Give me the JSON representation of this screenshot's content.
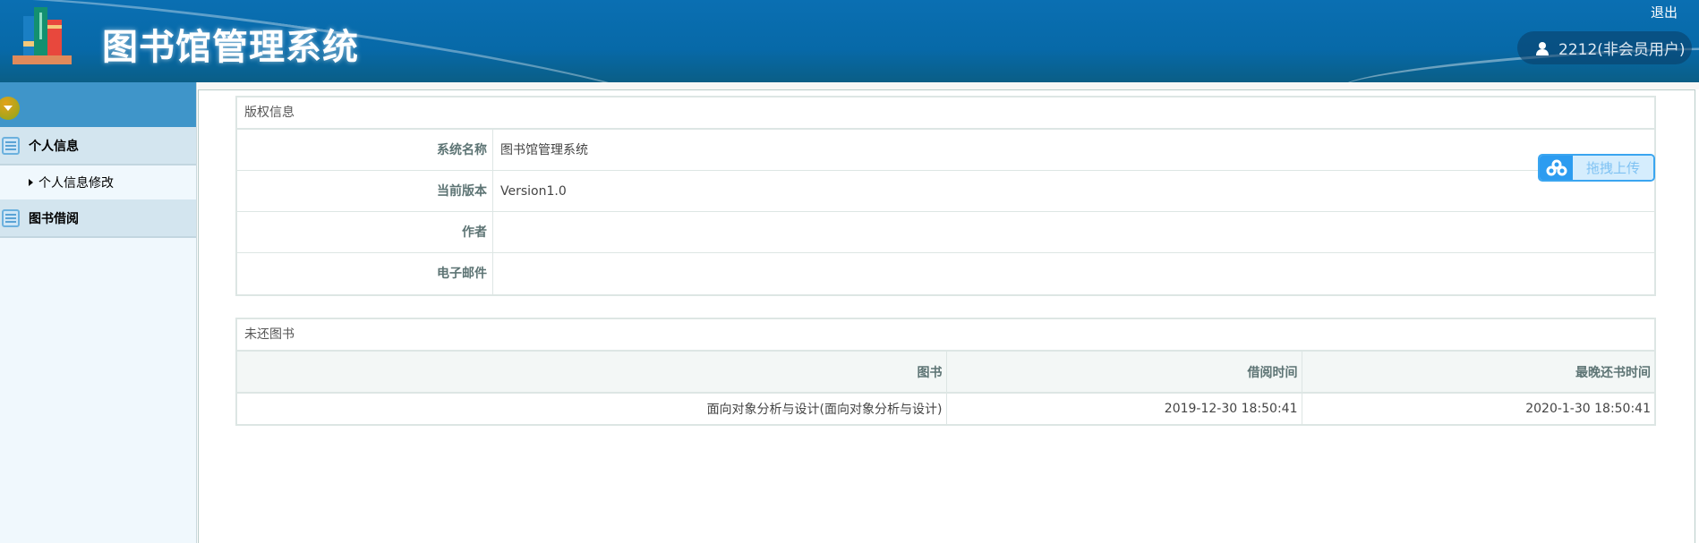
{
  "header": {
    "title": "图书馆管理系统",
    "logout": "退出",
    "user": "2212(非会员用户)"
  },
  "sidebar": {
    "groups": [
      {
        "label": "个人信息",
        "items": [
          {
            "label": "个人信息修改"
          }
        ]
      },
      {
        "label": "图书借阅",
        "items": []
      }
    ]
  },
  "copyright": {
    "title": "版权信息",
    "rows": [
      {
        "label": "系统名称",
        "value": "图书馆管理系统"
      },
      {
        "label": "当前版本",
        "value": "Version1.0"
      },
      {
        "label": "作者",
        "value": ""
      },
      {
        "label": "电子邮件",
        "value": ""
      }
    ]
  },
  "unreturned": {
    "title": "未还图书",
    "columns": [
      "图书",
      "借阅时间",
      "最晚还书时间"
    ],
    "rows": [
      [
        "面向对象分析与设计(面向对象分析与设计)",
        "2019-12-30 18:50:41",
        "2020-1-30 18:50:41"
      ]
    ]
  },
  "upload": {
    "label": "拖拽上传"
  }
}
